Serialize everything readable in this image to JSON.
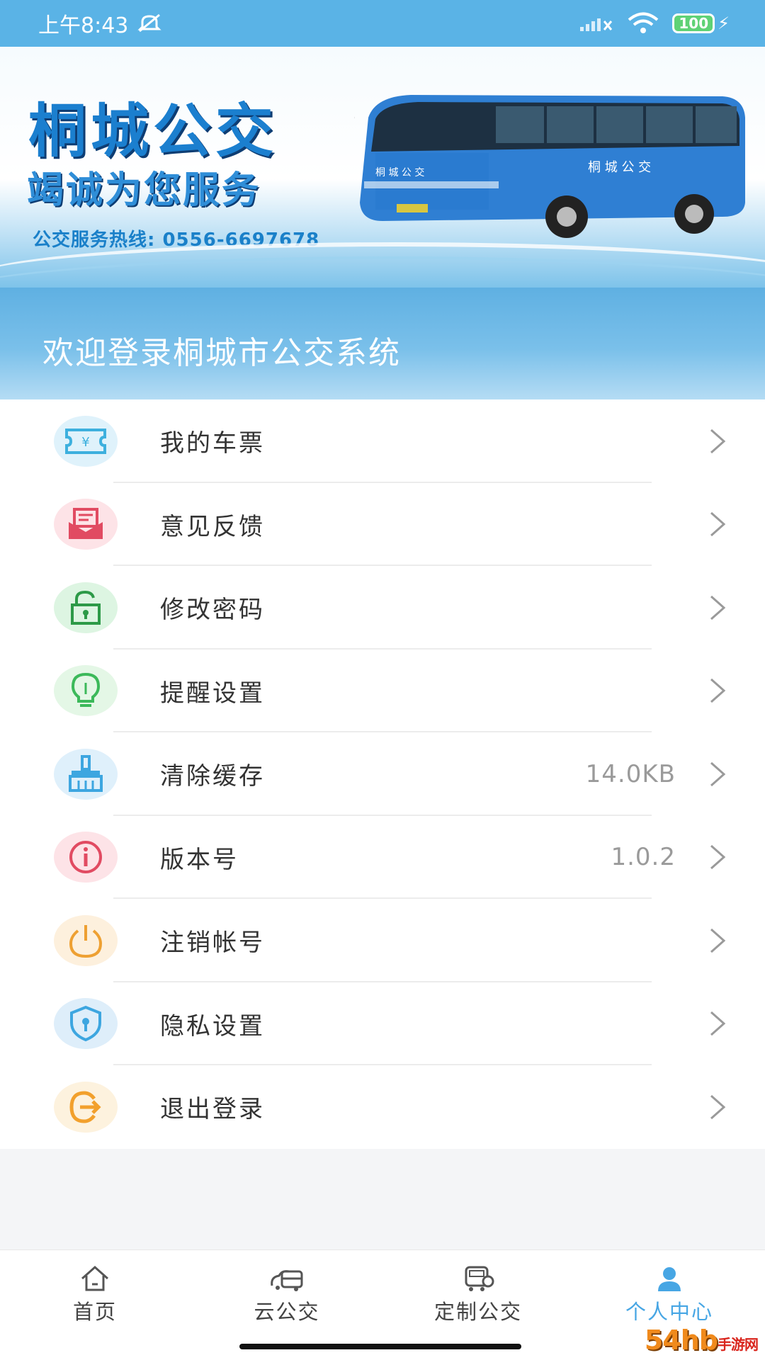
{
  "status_bar": {
    "time": "上午8:43",
    "battery": "100"
  },
  "banner": {
    "title": "桐城公交",
    "subtitle": "竭诚为您服务",
    "hotline": "公交服务热线: 0556-6697678",
    "bus_side_text": "桐 城 公 交",
    "bus_front_text": "桐 城 公 交"
  },
  "welcome": "欢迎登录桐城市公交系统",
  "menu": [
    {
      "label": "我的车票",
      "value": "",
      "icon": "ticket-icon",
      "color": "#3db0de",
      "bg": "#dff2fb"
    },
    {
      "label": "意见反馈",
      "value": "",
      "icon": "feedback-icon",
      "color": "#e14b62",
      "bg": "#fde3e7"
    },
    {
      "label": "修改密码",
      "value": "",
      "icon": "unlock-icon",
      "color": "#3cb95a",
      "bg": "#ddf5e2"
    },
    {
      "label": "提醒设置",
      "value": "",
      "icon": "bulb-icon",
      "color": "#3cb95a",
      "bg": "#e4f7e6"
    },
    {
      "label": "清除缓存",
      "value": "14.0KB",
      "icon": "broom-icon",
      "color": "#3da6e0",
      "bg": "#dff0fb"
    },
    {
      "label": "版本号",
      "value": "1.0.2",
      "icon": "info-icon",
      "color": "#e14b62",
      "bg": "#fde3e7"
    },
    {
      "label": "注销帐号",
      "value": "",
      "icon": "power-icon",
      "color": "#eea032",
      "bg": "#fdf0dd"
    },
    {
      "label": "隐私设置",
      "value": "",
      "icon": "shield-icon",
      "color": "#3da6e0",
      "bg": "#deeefa"
    },
    {
      "label": "退出登录",
      "value": "",
      "icon": "logout-icon",
      "color": "#f2a02c",
      "bg": "#fdf2de"
    }
  ],
  "tabs": [
    {
      "label": "首页",
      "icon": "home-icon",
      "active": false
    },
    {
      "label": "云公交",
      "icon": "bus-icon",
      "active": false
    },
    {
      "label": "定制公交",
      "icon": "custom-bus-icon",
      "active": false
    },
    {
      "label": "个人中心",
      "icon": "user-icon",
      "active": true
    }
  ],
  "colors": {
    "accent": "#47a6e4",
    "header": "#5ab3e6"
  },
  "watermark": {
    "main": "54hb",
    "suffix": "手游网"
  }
}
